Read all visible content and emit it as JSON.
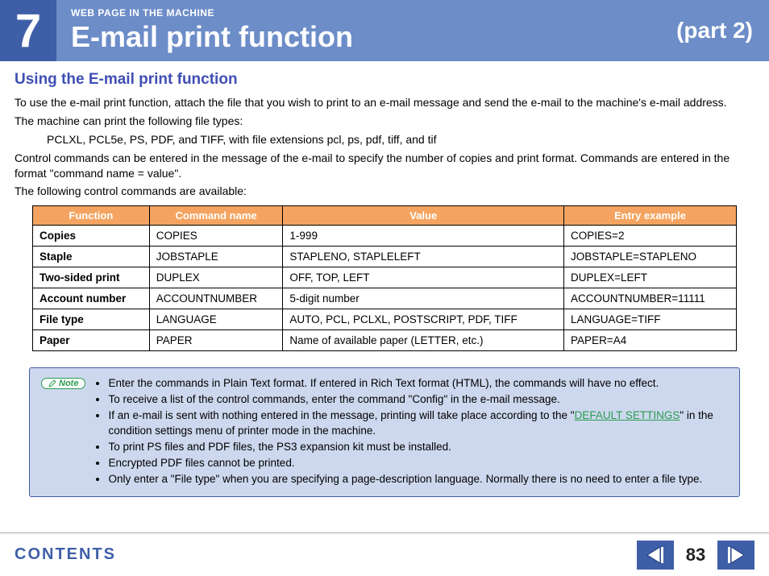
{
  "header": {
    "chapter_number": "7",
    "overline": "WEB PAGE IN THE MACHINE",
    "title": "E-mail print function",
    "part": "(part 2)"
  },
  "section_title": "Using the E-mail print function",
  "paragraphs": {
    "p1": "To use the e-mail print function, attach the file that you wish to print to an e-mail message and send the e-mail to the machine's e-mail address.",
    "p2": "The machine can print the following file types:",
    "file_types": "PCLXL, PCL5e, PS, PDF, and TIFF, with file extensions pcl, ps, pdf, tiff, and tif",
    "p3": "Control commands can be entered in the message of the e-mail to specify the number of copies and print format. Commands are entered in the format \"command name = value\".",
    "p4": "The following control commands are available:"
  },
  "table": {
    "headers": [
      "Function",
      "Command name",
      "Value",
      "Entry example"
    ],
    "rows": [
      [
        "Copies",
        "COPIES",
        "1-999",
        "COPIES=2"
      ],
      [
        "Staple",
        "JOBSTAPLE",
        "STAPLENO, STAPLELEFT",
        "JOBSTAPLE=STAPLENO"
      ],
      [
        "Two-sided print",
        "DUPLEX",
        "OFF, TOP, LEFT",
        "DUPLEX=LEFT"
      ],
      [
        "Account number",
        "ACCOUNTNUMBER",
        "5-digit number",
        "ACCOUNTNUMBER=11111"
      ],
      [
        "File type",
        "LANGUAGE",
        "AUTO, PCL, PCLXL, POSTSCRIPT, PDF, TIFF",
        "LANGUAGE=TIFF"
      ],
      [
        "Paper",
        "PAPER",
        "Name of available paper (LETTER, etc.)",
        "PAPER=A4"
      ]
    ]
  },
  "note": {
    "badge": "Note",
    "items": {
      "n1": "Enter the commands in Plain Text format. If entered in Rich Text format (HTML), the commands will have no effect.",
      "n2": "To receive a list of the control commands, enter the command \"Config\" in the e-mail message.",
      "n3a": "If an e-mail is sent with nothing entered in the message, printing will take place according to the \"",
      "n3link": "DEFAULT SETTINGS",
      "n3b": "\" in the condition settings menu of printer mode in the machine.",
      "n4": "To print PS files and PDF files, the PS3 expansion kit must be installed.",
      "n5": "Encrypted PDF files cannot be printed.",
      "n6": "Only enter a \"File type\" when you are specifying a page-description language. Normally there is no need to enter a file type."
    }
  },
  "footer": {
    "contents": "CONTENTS",
    "page": "83"
  }
}
